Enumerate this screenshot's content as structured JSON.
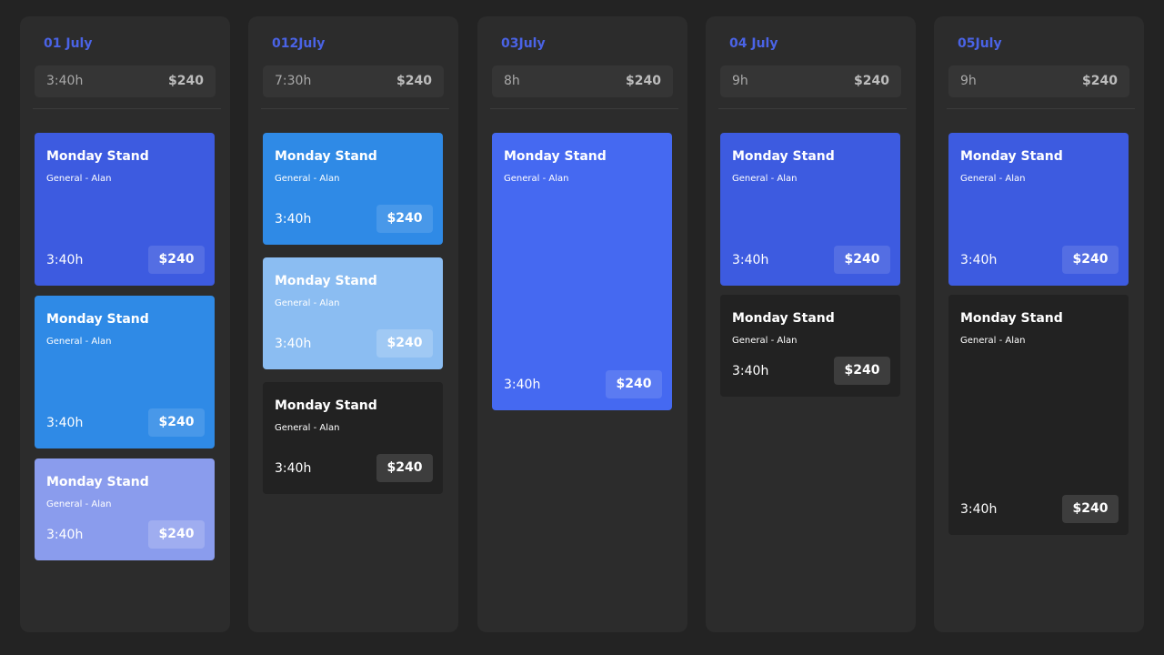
{
  "columns": [
    {
      "date": "01 July",
      "summary": {
        "duration": "3:40h",
        "price": "$240"
      },
      "cards": [
        {
          "title": "Monday Stand",
          "subtitle": "General - Alan",
          "duration": "3:40h",
          "price": "$240",
          "color": "#3d5be0"
        },
        {
          "title": "Monday Stand",
          "subtitle": "General - Alan",
          "duration": "3:40h",
          "price": "$240",
          "color": "#2f8ae6"
        },
        {
          "title": "Monday Stand",
          "subtitle": "General - Alan",
          "duration": "3:40h",
          "price": "$240",
          "color": "#8a9ced"
        }
      ]
    },
    {
      "date": "012July",
      "summary": {
        "duration": "7:30h",
        "price": "$240"
      },
      "cards": [
        {
          "title": "Monday Stand",
          "subtitle": "General - Alan",
          "duration": "3:40h",
          "price": "$240",
          "color": "#2f8ae6"
        },
        {
          "title": "Monday Stand",
          "subtitle": "General - Alan",
          "duration": "3:40h",
          "price": "$240",
          "color": "#8bbdf2"
        },
        {
          "title": "Monday Stand",
          "subtitle": "General - Alan",
          "duration": "3:40h",
          "price": "$240",
          "color": "#222222"
        }
      ]
    },
    {
      "date": "03July",
      "summary": {
        "duration": "8h",
        "price": "$240"
      },
      "cards": [
        {
          "title": "Monday Stand",
          "subtitle": "General - Alan",
          "duration": "3:40h",
          "price": "$240",
          "color": "#4569f1"
        }
      ]
    },
    {
      "date": "04 July",
      "summary": {
        "duration": "9h",
        "price": "$240"
      },
      "cards": [
        {
          "title": "Monday Stand",
          "subtitle": "General - Alan",
          "duration": "3:40h",
          "price": "$240",
          "color": "#3d5be0"
        },
        {
          "title": "Monday Stand",
          "subtitle": "General - Alan",
          "duration": "3:40h",
          "price": "$240",
          "color": "#222222"
        }
      ]
    },
    {
      "date": "05July",
      "summary": {
        "duration": "9h",
        "price": "$240"
      },
      "cards": [
        {
          "title": "Monday Stand",
          "subtitle": "General - Alan",
          "duration": "3:40h",
          "price": "$240",
          "color": "#3d5be0"
        },
        {
          "title": "Monday Stand",
          "subtitle": "General - Alan",
          "duration": "3:40h",
          "price": "$240",
          "color": "#222222"
        }
      ]
    }
  ],
  "colors": {
    "background": "#232323",
    "column": "#2c2c2c",
    "date_accent": "#4a63e6"
  }
}
